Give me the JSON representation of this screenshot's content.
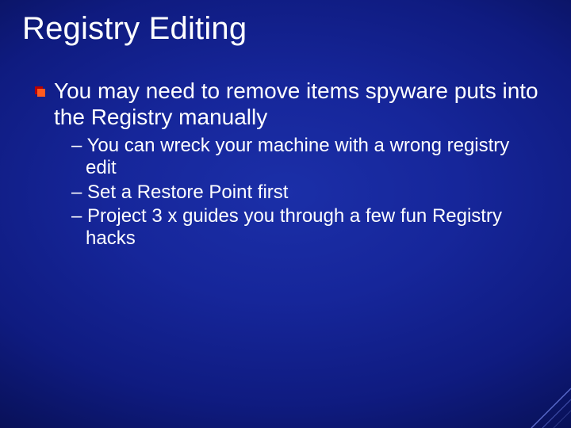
{
  "title": "Registry Editing",
  "main_bullet": "You may need to remove items spyware puts into the Registry manually",
  "sub_bullets": {
    "0": "You can wreck your machine with a wrong registry edit",
    "1": "Set a Restore Point first",
    "2": "Project 3 x guides you through a few fun Registry hacks"
  },
  "dash": "– "
}
